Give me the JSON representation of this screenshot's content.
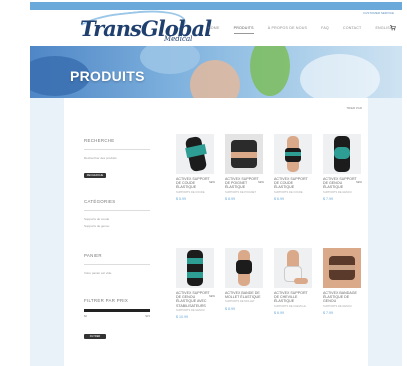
{
  "header": {
    "top_link": "CUSTOMER SERVICE",
    "logo_word": "TransGlobal",
    "logo_sub": "Medical",
    "nav": [
      "HOME",
      "PRODUITS",
      "À PROPOS DE NOUS",
      "FAQ",
      "CONTACT",
      "ENGLISH"
    ],
    "active_nav_index": 1
  },
  "banner": {
    "title": "PRODUITS"
  },
  "sort_label": "TRIER PAR",
  "sidebar": {
    "search_heading": "RECHERCHE",
    "search_placeholder": "Rechercher des produits",
    "search_button": "RECHERCHE",
    "categories_heading": "CATÉGORIES",
    "categories": [
      "Supports de coude",
      "Supports de genou"
    ],
    "cart_heading": "PANIER",
    "cart_empty": "Votre panier est vide.",
    "filter_heading": "FILTRER PAR PRIX",
    "filter_min": "$0",
    "filter_max": "$15",
    "filter_button": "FILTRER"
  },
  "products": [
    {
      "title": "ACTIVEX SUPPORT DE COUDE ÉLASTIQUE",
      "sub": "SUPPORTS DE COUDE",
      "price": "$ 5.99",
      "tag": "NEW"
    },
    {
      "title": "ACTIVEX SUPPORT DE POIGNET ÉLASTIQUE",
      "sub": "SUPPORTS DE POIGNET",
      "price": "$ 8.99",
      "tag": "NEW"
    },
    {
      "title": "ACTIVEX SUPPORT DE COUDE ÉLASTIQUE",
      "sub": "SUPPORTS DE COUDE",
      "price": "$ 6.99",
      "tag": ""
    },
    {
      "title": "ACTIVEX SUPPORT DE GENOU ÉLASTIQUE",
      "sub": "SUPPORTS DE GENOU",
      "price": "$ 7.99",
      "tag": "NEW"
    },
    {
      "title": "ACTIVEX SUPPORT DE GENOU ÉLASTIQUE AVEC STABILISATEURS",
      "sub": "SUPPORTS DE GENOU",
      "price": "$ 10.99",
      "tag": "NEW"
    },
    {
      "title": "ACTIVEX BANDE DE MOLLET ÉLASTIQUE",
      "sub": "SUPPORTS DE MOLLET",
      "price": "$ 8.99",
      "tag": ""
    },
    {
      "title": "ACTIVEX SUPPORT DE CHEVILLE ÉLASTIQUE",
      "sub": "SUPPORTS DE CHEVILLE",
      "price": "$ 6.99",
      "tag": ""
    },
    {
      "title": "ACTIVEX BANDAGE ÉLASTIQUE DE GENOU",
      "sub": "SUPPORTS DE GENOU",
      "price": "$ 7.99",
      "tag": ""
    }
  ],
  "colors": {
    "accent": "#6aa9d9",
    "brand": "#1f3f6e",
    "product_green": "#2e9e95",
    "product_black": "#1c1c1c"
  },
  "icons": {
    "cart": "shopping-cart-icon"
  }
}
